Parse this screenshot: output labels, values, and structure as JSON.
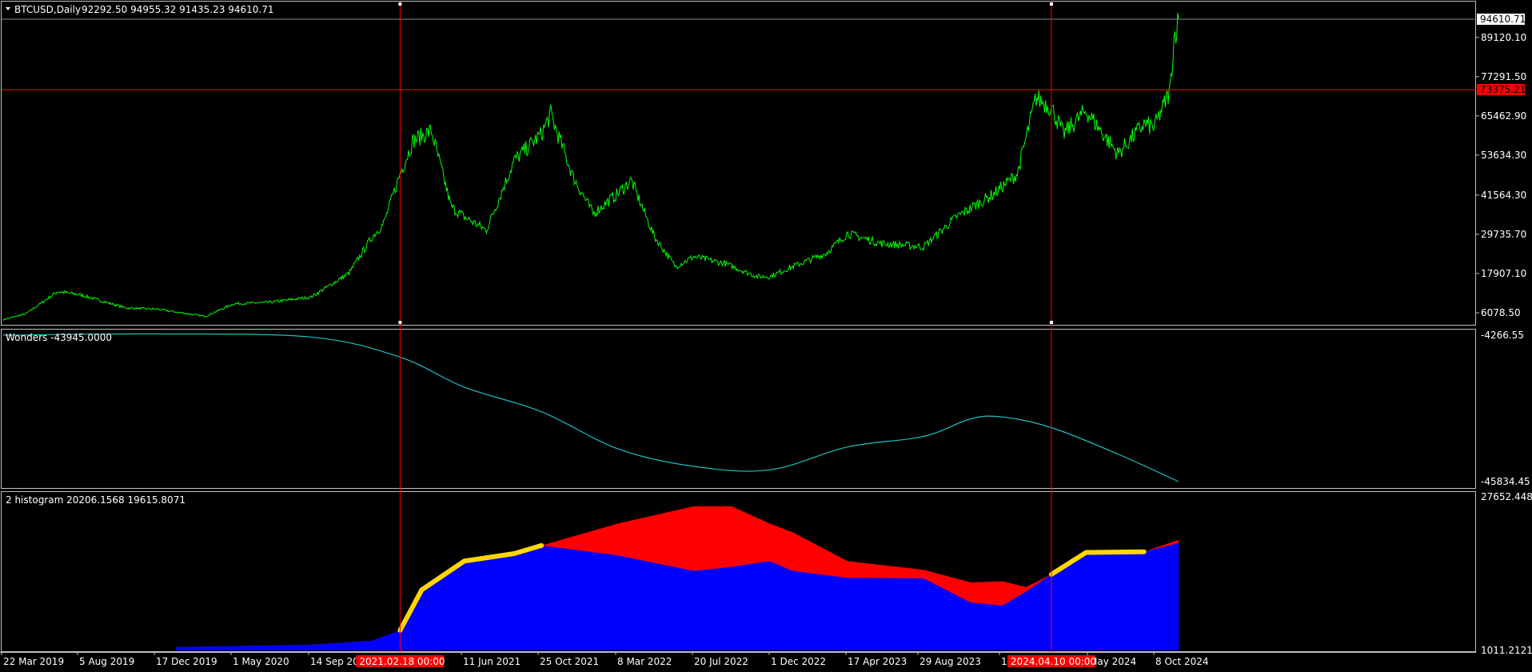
{
  "main_panel": {
    "header": {
      "symbol": "BTCUSD,Daily",
      "ohlc": "92292.50 94955.32 91435.23 94610.71"
    },
    "price_ticks": [
      "89120.10",
      "77291.50",
      "65462.90",
      "53634.30",
      "41564.30",
      "29735.70",
      "17907.10",
      "6078.50"
    ],
    "current_price_label": "94610.71",
    "hline_price_label": "73375.21",
    "colors": {
      "price_line": "#00ff00",
      "hline": "#ff0000",
      "vline": "#ff0000",
      "current_box": "#ffffff",
      "hline_box": "#ff0000"
    }
  },
  "wonders_panel": {
    "label": "Wonders -43945.0000",
    "ticks": [
      "-4266.55",
      "-45834.45"
    ],
    "colors": {
      "line": "#20c0c0"
    }
  },
  "histogram_panel": {
    "label": "2 histogram 20206.1568 19615.8071",
    "ticks": [
      "27652.4487",
      "1011.2121"
    ],
    "colors": {
      "red": "#ff0000",
      "blue": "#0000ff",
      "yellow": "#ffd700"
    }
  },
  "time_axis": {
    "labels": [
      "22 Mar 2019",
      "5 Aug 2019",
      "17 Dec 2019",
      "1 May 2020",
      "14 Sep 20",
      "11 Jun 2021",
      "25 Oct 2021",
      "8 Mar 2022",
      "20 Jul 2022",
      "1 Dec 2022",
      "17 Apr 2023",
      "29 Aug 2023",
      "1",
      "May 2024",
      "8 Oct 2024"
    ],
    "cursor_labels": [
      "2021.02.18 00:00",
      "2024.04.10 00:00"
    ]
  },
  "chart_data": [
    {
      "type": "line",
      "title": "BTCUSD,Daily",
      "series": [
        {
          "name": "BTCUSD",
          "x": [
            "2019-03-22",
            "2019-05-01",
            "2019-06-26",
            "2019-08-05",
            "2019-10-25",
            "2019-12-17",
            "2020-03-12",
            "2020-05-01",
            "2020-07-01",
            "2020-09-14",
            "2020-11-20",
            "2020-12-31",
            "2021-01-20",
            "2021-02-18",
            "2021-03-13",
            "2021-04-14",
            "2021-05-19",
            "2021-06-11",
            "2021-07-20",
            "2021-09-07",
            "2021-10-25",
            "2021-11-10",
            "2021-12-20",
            "2022-01-24",
            "2022-03-08",
            "2022-04-01",
            "2022-05-12",
            "2022-06-18",
            "2022-07-20",
            "2022-09-12",
            "2022-11-09",
            "2022-12-01",
            "2023-01-10",
            "2023-03-10",
            "2023-04-17",
            "2023-06-15",
            "2023-08-29",
            "2023-10-26",
            "2023-12-31",
            "2024-02-10",
            "2024-03-14",
            "2024-04-10",
            "2024-05-01",
            "2024-06-10",
            "2024-08-05",
            "2024-09-20",
            "2024-10-08",
            "2024-11-05",
            "2024-11-12",
            "2024-11-20"
          ],
          "values": [
            4000,
            5800,
            12500,
            11500,
            7500,
            7200,
            5000,
            8800,
            9200,
            10800,
            18000,
            29000,
            33000,
            48000,
            58000,
            61000,
            38000,
            35000,
            31000,
            52000,
            60000,
            66000,
            47000,
            36000,
            42000,
            46000,
            29000,
            20000,
            23000,
            21000,
            17000,
            17000,
            20000,
            24000,
            30000,
            27000,
            26000,
            35000,
            42000,
            48000,
            71000,
            68000,
            60000,
            67000,
            54000,
            63000,
            62000,
            73000,
            89000,
            94610.71
          ]
        }
      ],
      "annotations": {
        "hline": 73375.21,
        "vlines": [
          "2021-02-18",
          "2024-04-10"
        ]
      },
      "ylim": [
        6078.5,
        94610.71
      ],
      "grid": false
    },
    {
      "type": "line",
      "title": "Wonders -43945.0000",
      "series": [
        {
          "x": [
            "2019-03-22",
            "2019-12-17",
            "2020-09-14",
            "2021-02-18",
            "2021-06-11",
            "2021-10-25",
            "2022-03-08",
            "2022-07-20",
            "2022-12-01",
            "2023-04-17",
            "2023-08-29",
            "2023-11-20",
            "2024-01-15",
            "2024-04-10",
            "2024-08-05",
            "2024-11-20"
          ],
          "values": [
            -4266.55,
            -3900,
            -4800,
            -10500,
            -19000,
            -26000,
            -36500,
            -41500,
            -42500,
            -36000,
            -33000,
            -28000,
            -27500,
            -30500,
            -38000,
            -45834.45
          ]
        }
      ],
      "ylim": [
        -45834.45,
        -4266.55
      ]
    },
    {
      "type": "area",
      "title": "2 histogram 20206.1568 19615.8071",
      "x": [
        "2020-01-20",
        "2020-09-14",
        "2020-12-31",
        "2021-02-18",
        "2021-03-28",
        "2021-06-11",
        "2021-09-07",
        "2021-10-25",
        "2022-03-08",
        "2022-07-20",
        "2022-09-25",
        "2022-12-01",
        "2023-01-10",
        "2023-04-17",
        "2023-08-29",
        "2023-11-20",
        "2024-01-15",
        "2024-02-25",
        "2024-04-10",
        "2024-06-10",
        "2024-09-20",
        "2024-11-20"
      ],
      "series": [
        {
          "values": [
            1600,
            2000,
            2700,
            4500,
            11500,
            16500,
            17800,
            19200,
            17500,
            14800,
            15500,
            16500,
            14800,
            13600,
            13500,
            9300,
            8800,
            11200,
            14200,
            18000,
            18100,
            20206.1568
          ]
        },
        {
          "values": [
            1600,
            2000,
            2700,
            4500,
            11500,
            16500,
            17800,
            19200,
            23000,
            26000,
            26000,
            23000,
            21500,
            16500,
            15000,
            12800,
            13000,
            12000,
            14200,
            18000,
            18100,
            19615.8071
          ]
        }
      ],
      "ylim": [
        1011.2121,
        27652.4487
      ]
    }
  ]
}
